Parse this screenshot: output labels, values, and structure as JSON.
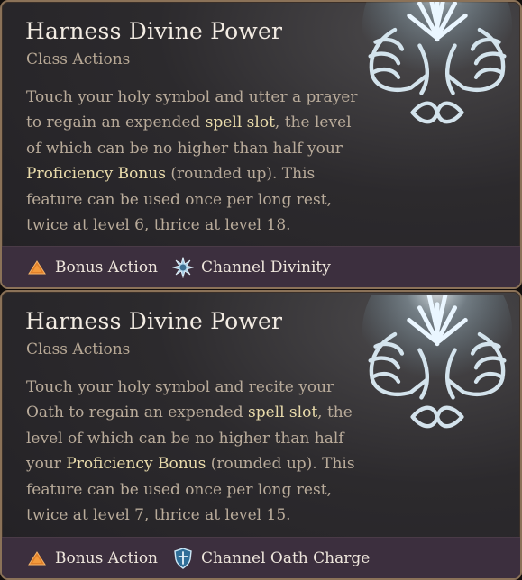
{
  "colors": {
    "keyword": "#e9dbab",
    "card_border": "#8b7258",
    "footer_bg": "#3c2f3e",
    "bonus_action_triangle": "#e0802a",
    "channel_divinity_star": "#a9cfe6"
  },
  "cards": [
    {
      "title": "Harness Divine Power",
      "subtitle": "Class Actions",
      "art_icon": "praying-hands-divine-light-icon",
      "description": [
        "Touch your holy symbol and utter a prayer to regain an expended ",
        "spell slot",
        ", the level of which can be no higher than half your ",
        "Proficiency Bonus",
        " (rounded up). This feature can be used once per long rest, twice at level 6, thrice at level 18."
      ],
      "footer": [
        {
          "icon": "bonus-action-triangle-icon",
          "label": "Bonus Action"
        },
        {
          "icon": "channel-divinity-star-icon",
          "label": "Channel Divinity"
        }
      ]
    },
    {
      "title": "Harness Divine Power",
      "subtitle": "Class Actions",
      "art_icon": "praying-hands-divine-light-icon",
      "description": [
        "Touch your holy symbol and recite your Oath to regain an expended ",
        "spell slot",
        ", the level of which can be no higher than half your ",
        "Proficiency Bonus",
        " (rounded up). This feature can be used once per long rest, twice at level 7, thrice at level 15."
      ],
      "footer": [
        {
          "icon": "bonus-action-triangle-icon",
          "label": "Bonus Action"
        },
        {
          "icon": "channel-oath-charge-shield-icon",
          "label": "Channel Oath Charge"
        }
      ]
    }
  ]
}
